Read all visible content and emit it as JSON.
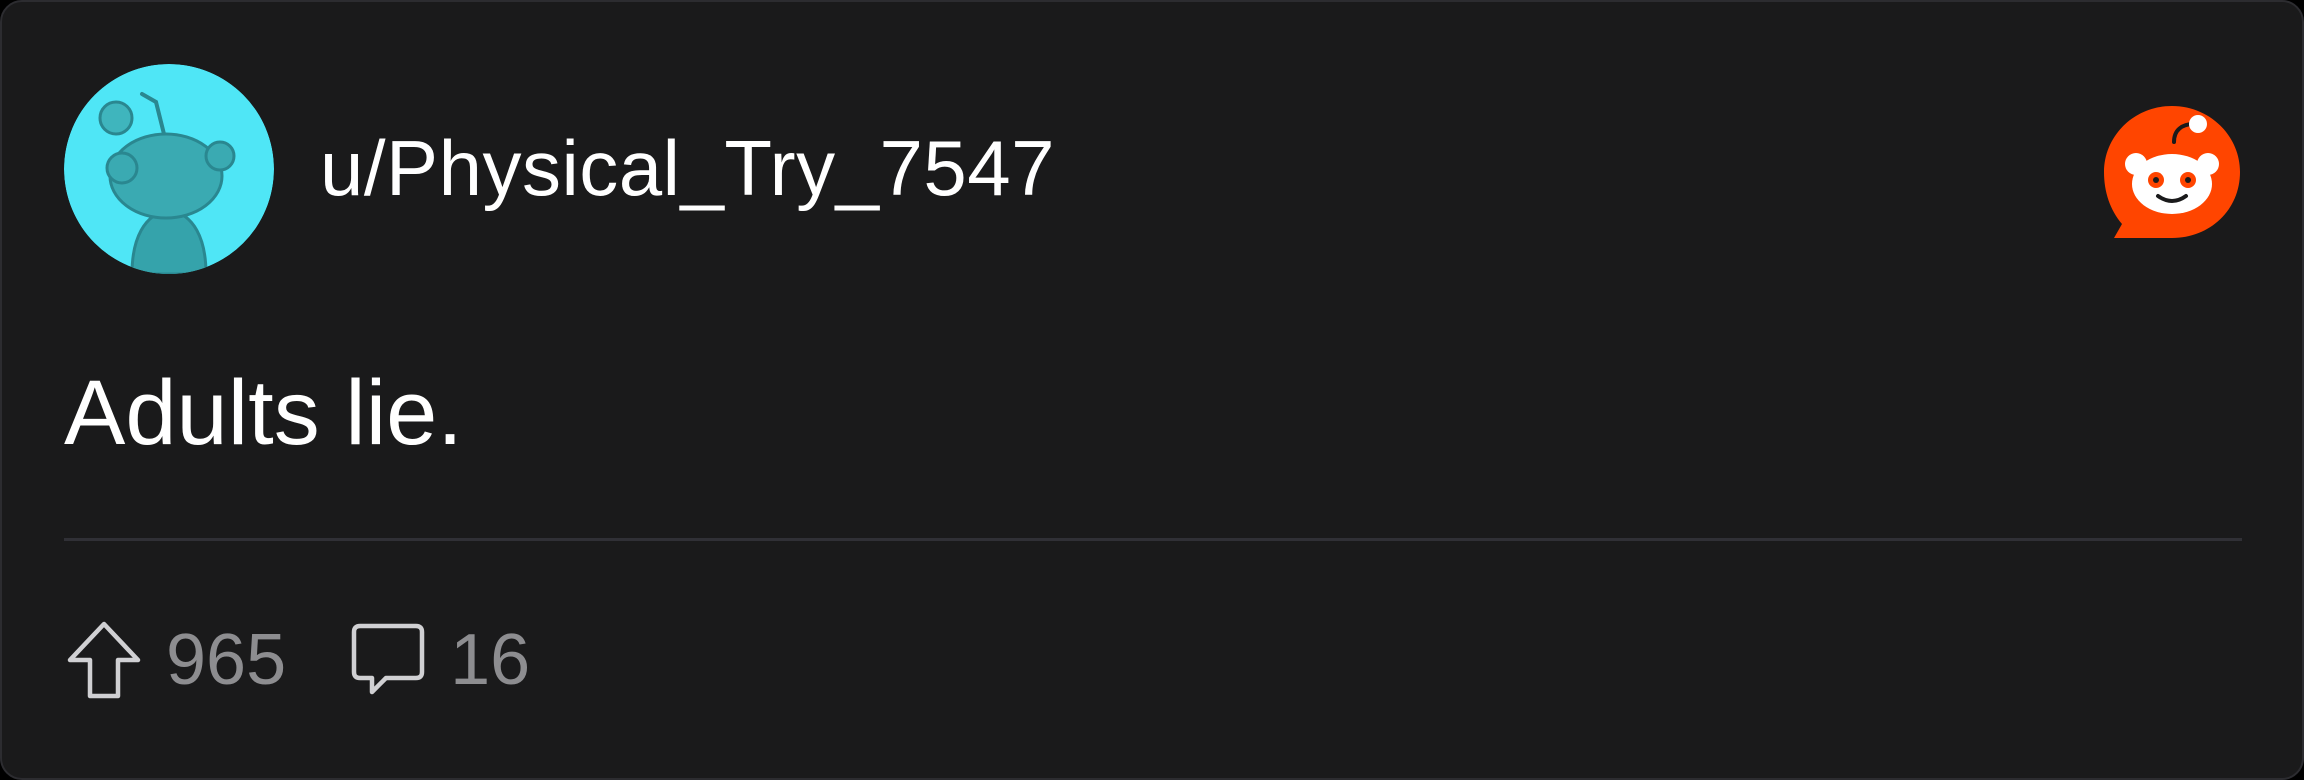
{
  "post": {
    "username": "u/Physical_Try_7547",
    "text": "Adults lie."
  },
  "stats": {
    "upvotes": "965",
    "comments": "16"
  },
  "icons": {
    "avatar": "snoo-avatar-icon",
    "logo": "reddit-logo-icon",
    "upvote": "upvote-arrow-icon",
    "comment": "comment-bubble-icon"
  },
  "colors": {
    "card_background": "#1a1a1b",
    "avatar_background": "#4fe6f6",
    "reddit_orange": "#ff4500",
    "muted_text": "#8d8d90"
  }
}
